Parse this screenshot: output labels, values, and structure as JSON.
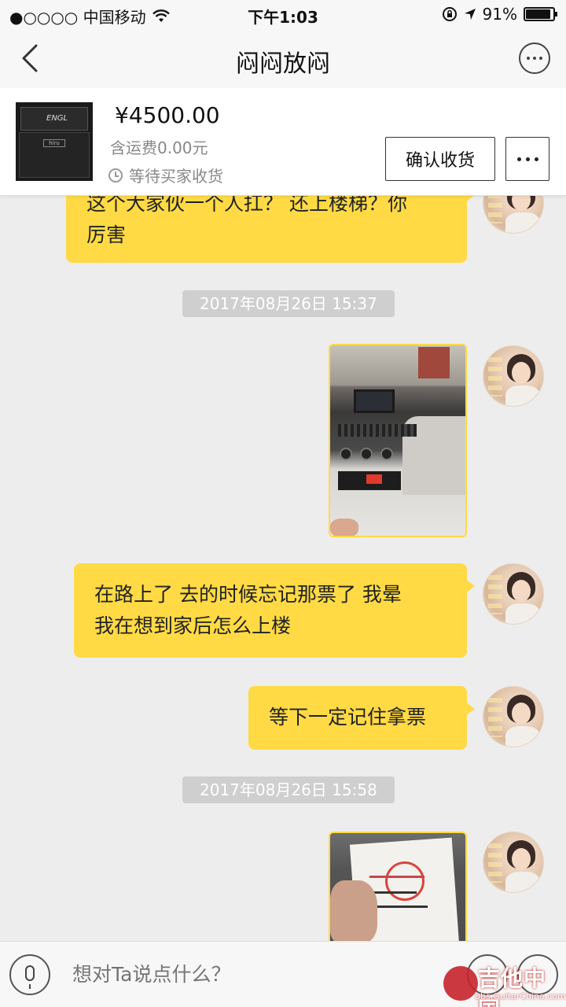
{
  "status_bar": {
    "carrier": "●○○○○ 中国移动",
    "time": "下午1:03",
    "battery": "91%",
    "battery_level": 0.91
  },
  "nav": {
    "title": "闷闷放闷"
  },
  "product": {
    "price": "¥4500.00",
    "shipping": "含运费0.00元",
    "status": "等待买家收货",
    "confirm_label": "确认收货"
  },
  "messages": [
    {
      "type": "text",
      "side": "right",
      "lines": [
        "这个大家伙一个人扛？ 还上楼梯？你",
        "厉害"
      ]
    },
    {
      "type": "timestamp",
      "text": "2017年08月26日 15:37"
    },
    {
      "type": "image",
      "side": "right",
      "subject": "car-interior-photo"
    },
    {
      "type": "text",
      "side": "right",
      "lines": [
        "在路上了 去的时候忘记那票了 我晕",
        "我在想到家后怎么上楼"
      ]
    },
    {
      "type": "text",
      "side": "right",
      "lines": [
        "等下一定记住拿票"
      ]
    },
    {
      "type": "timestamp",
      "text": "2017年08月26日 15:58"
    },
    {
      "type": "image",
      "side": "right",
      "subject": "taxi-receipt-photo"
    }
  ],
  "input": {
    "placeholder": "想对Ta说点什么？"
  },
  "watermark": {
    "cn": "吉他中国",
    "en": "bbs.GuitarChina.com"
  },
  "colors": {
    "bubble": "#ffda44",
    "background": "#ededed",
    "timestamp_bg": "#cfcfcf"
  }
}
